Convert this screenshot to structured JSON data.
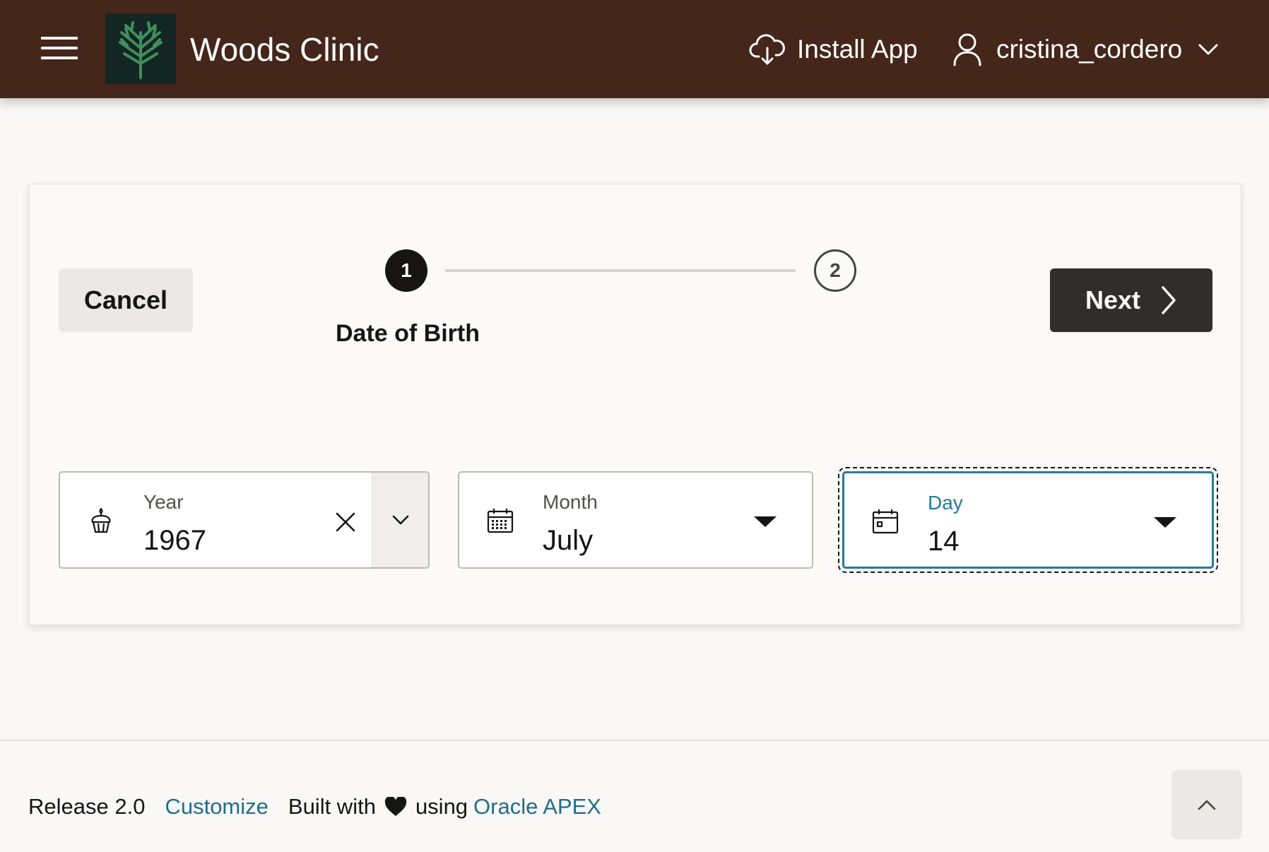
{
  "header": {
    "app_title": "Woods Clinic",
    "install_label": "Install App",
    "username": "cristina_cordero",
    "background_color": "#44261a",
    "icons": [
      "menu-icon",
      "tree-logo-icon",
      "cloud-download-icon",
      "user-icon",
      "chevron-down-icon"
    ]
  },
  "wizard": {
    "cancel_label": "Cancel",
    "next_label": "Next",
    "steps": [
      {
        "number": "1",
        "label": "Date of Birth",
        "state": "current"
      },
      {
        "number": "2",
        "label": "",
        "state": "upcoming"
      }
    ]
  },
  "form": {
    "year": {
      "label": "Year",
      "value": "1967",
      "icon": "cupcake-icon"
    },
    "month": {
      "label": "Month",
      "value": "July",
      "icon": "calendar-grid-icon"
    },
    "day": {
      "label": "Day",
      "value": "14",
      "icon": "calendar-day-icon",
      "focused": true
    }
  },
  "footer": {
    "release": "Release 2.0",
    "customize": "Customize",
    "built_with": "Built with",
    "using": "using",
    "apex_link": "Oracle APEX",
    "link_color": "#1e6e8c"
  },
  "colors": {
    "accent": "#257a9c",
    "primary_button": "#312d2a"
  }
}
